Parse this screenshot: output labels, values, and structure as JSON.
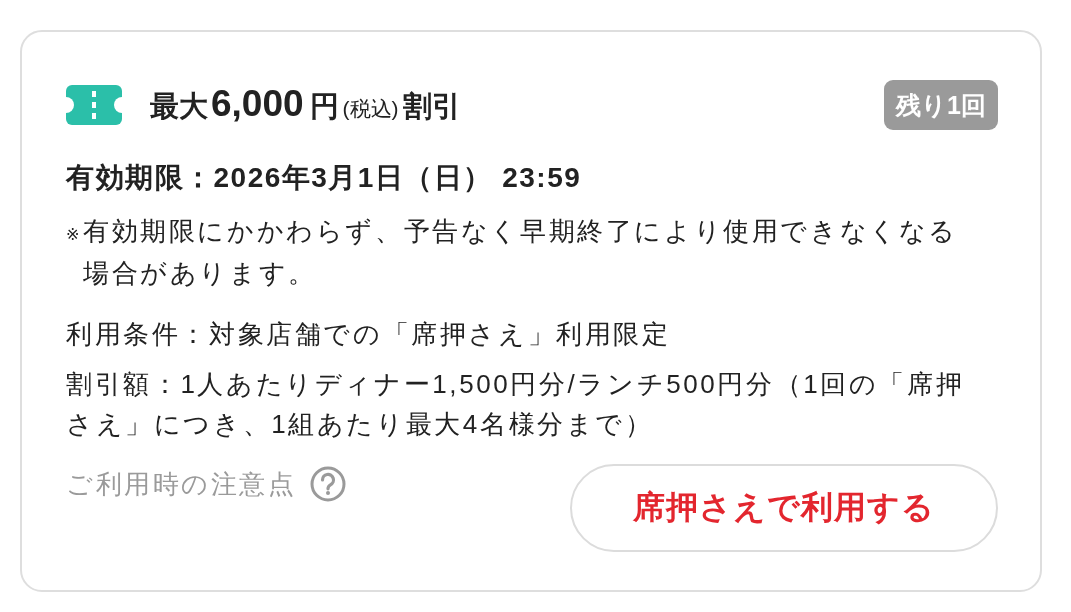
{
  "coupon": {
    "title": [
      {
        "kind": "label",
        "text": "最大"
      },
      {
        "kind": "amount",
        "text": "6,000"
      },
      {
        "kind": "unit",
        "text": "円"
      },
      {
        "kind": "note",
        "text": "(税込)"
      },
      {
        "kind": "label",
        "text": "割引"
      }
    ],
    "remaining_badge": "残り1回",
    "expiry": "有効期限：2026年3月1日（日） 23:59",
    "note": {
      "mark": "※",
      "text": "有効期限にかかわらず、予告なく早期終了により使用できなくなる場合があります。"
    },
    "conditions": [
      "利用条件：対象店舗での「席押さえ」利用限定",
      "割引額：1人あたりディナー1,500円分/ランチ500円分（1回の「席押さえ」につき、1組あたり最大4名様分まで）"
    ],
    "notes_link": "ご利用時の注意点",
    "use_button": "席押さえで利用する"
  }
}
